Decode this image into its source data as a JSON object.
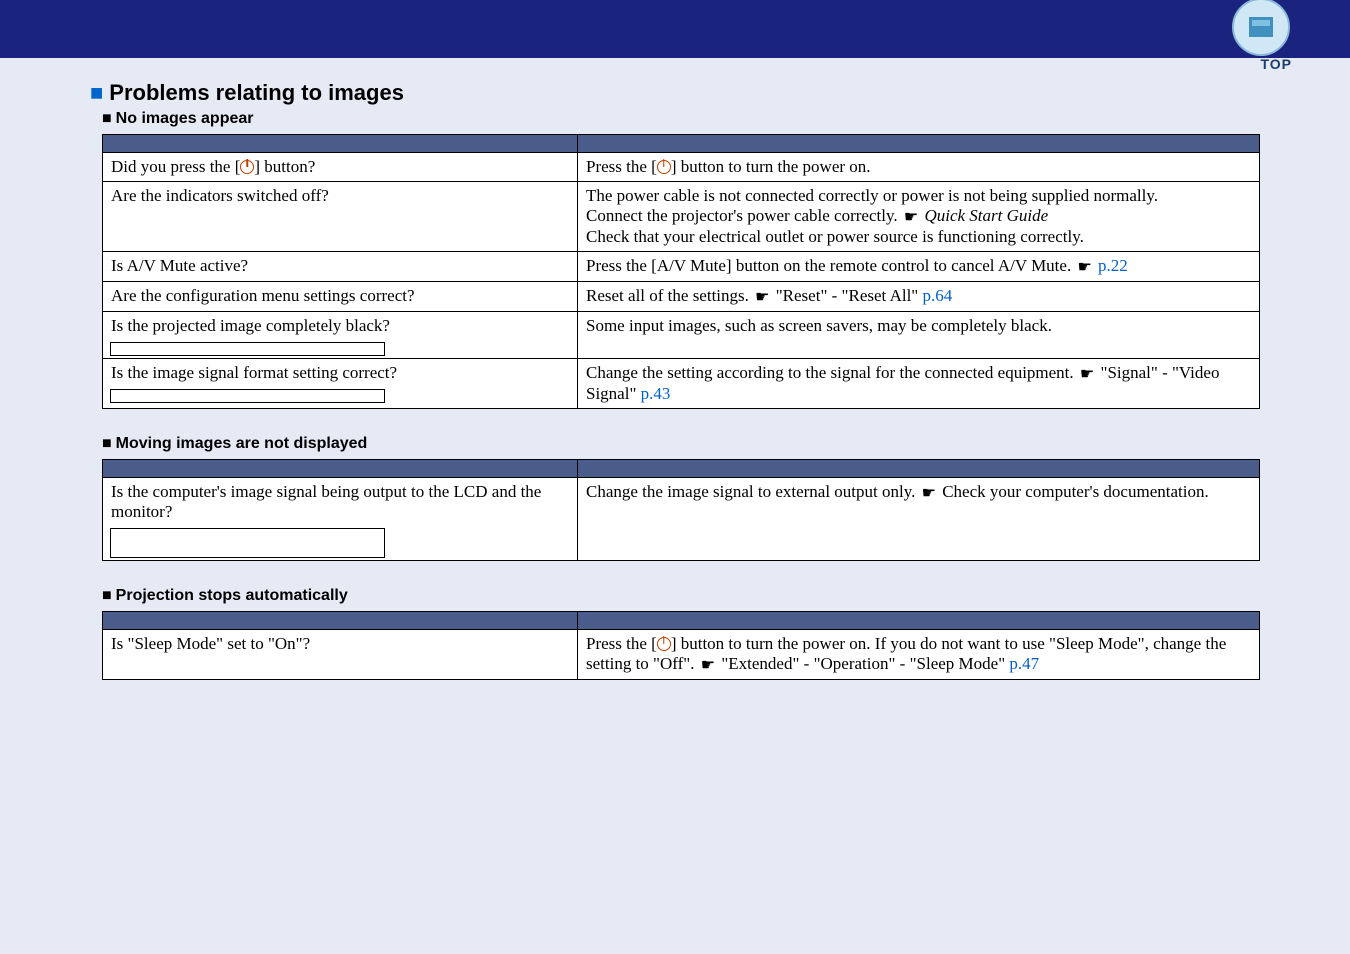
{
  "header": {
    "top_label": "TOP"
  },
  "sections": {
    "main_heading": "Problems relating to images",
    "table1": {
      "title": "No images appear",
      "rows": [
        {
          "check": "Did you press the [⏻] button?",
          "remedy": "Press the [⏻] button to turn the power on."
        },
        {
          "check": "Are the indicators switched off?",
          "remedy_parts": {
            "line1": "The power cable is not connected correctly or power is not being supplied normally.",
            "line2a": "Connect the projector's power cable correctly. ",
            "line2b": "Quick Start Guide",
            "line3": "Check that your electrical outlet or power source is functioning correctly."
          }
        },
        {
          "check": "Is A/V Mute active?",
          "remedy_a": "Press the [A/V Mute] button on the remote control to cancel A/V Mute. ",
          "remedy_link": "p.22"
        },
        {
          "check": "Are the configuration menu settings correct?",
          "remedy_a": "Reset all of the settings. ",
          "remedy_b": " \"Reset\" - \"Reset All\" ",
          "remedy_link": "p.64"
        },
        {
          "check": "Is the projected image completely black?",
          "remedy": "Some input images, such as screen savers, may be completely black.",
          "has_box": true
        },
        {
          "check": "Is the image signal format setting correct?",
          "remedy_a": "Change the setting according to the signal for the connected equipment. ",
          "remedy_b": " \"Signal\" - \"Video Signal\"  ",
          "remedy_link": "p.43",
          "has_box": true
        }
      ]
    },
    "table2": {
      "title": "Moving images are not displayed",
      "rows": [
        {
          "check": "Is the computer's image signal being output to the LCD and the monitor?",
          "remedy_a": "Change the image signal to external output only. ",
          "remedy_b": " Check your computer's documentation.",
          "has_box": true
        }
      ]
    },
    "table3": {
      "title": "Projection stops automatically",
      "rows": [
        {
          "check": "Is \"Sleep Mode\" set to \"On\"?",
          "remedy_a": "Press the [⏻] button to turn the power on. If you do not want to use \"Sleep Mode\", change the setting to \"Off\". ",
          "remedy_b": " \"Extended\" - \"Operation\" - \"Sleep Mode\" ",
          "remedy_link": "p.47"
        }
      ]
    }
  }
}
